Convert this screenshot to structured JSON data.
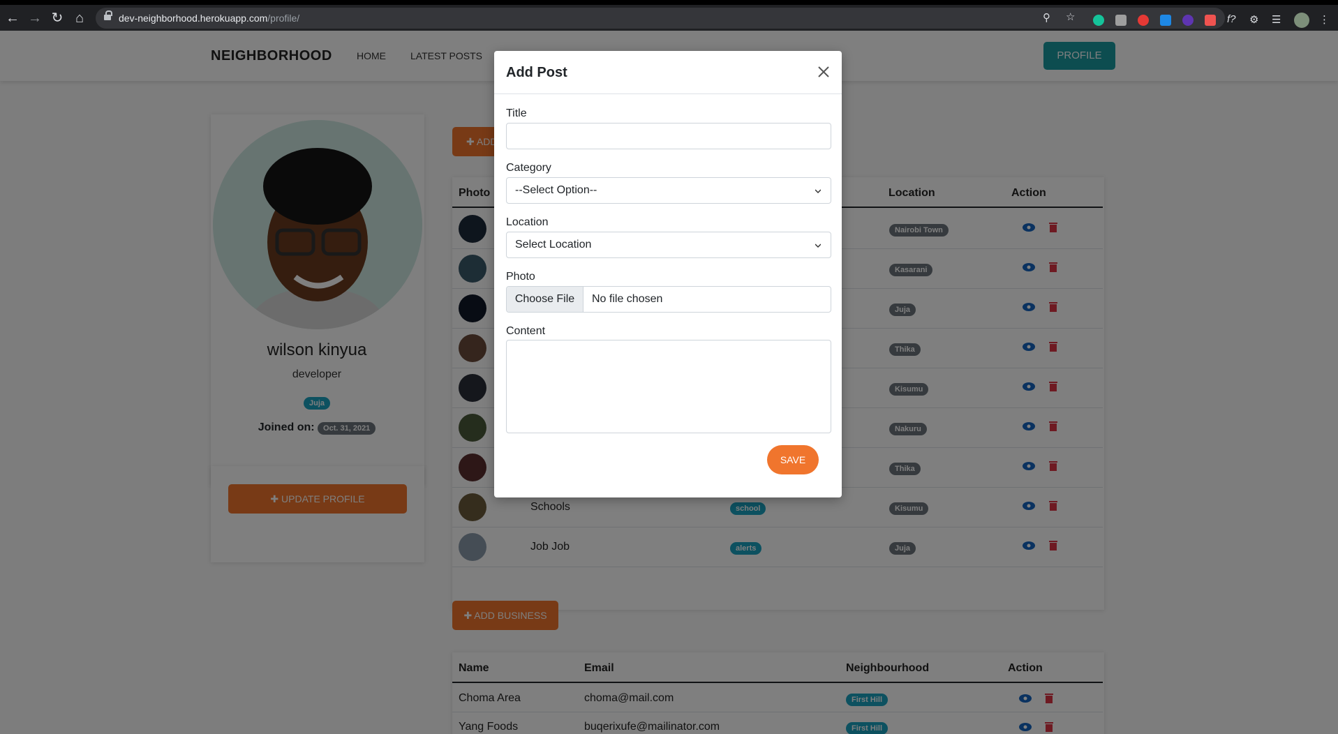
{
  "browser": {
    "url_host": "dev-neighborhood.herokuapp.com",
    "url_path": "/profile/"
  },
  "nav": {
    "brand": "NEIGHBORHOOD",
    "links": [
      "HOME",
      "LATEST POSTS"
    ],
    "profile_button": "PROFILE"
  },
  "profile": {
    "name": "wilson kinyua",
    "role": "developer",
    "location": "Juja",
    "joined_label": "Joined on:",
    "joined_date": "Oct. 31, 2021",
    "update_button": "UPDATE PROFILE"
  },
  "posts": {
    "add_button_partial": "ADD",
    "headers": {
      "photo": "Photo",
      "location": "Location",
      "action": "Action"
    },
    "rows": [
      {
        "title": "",
        "category": "",
        "location": "Nairobi Town"
      },
      {
        "title": "",
        "category": "",
        "location": "Kasarani"
      },
      {
        "title": "",
        "category": "",
        "location": "Juja"
      },
      {
        "title": "",
        "category": "",
        "location": "Thika"
      },
      {
        "title": "",
        "category": "",
        "location": "Kisumu"
      },
      {
        "title": "",
        "category": "",
        "location": "Nakuru"
      },
      {
        "title": "",
        "category": "",
        "location": "Thika"
      },
      {
        "title": "Schools",
        "category": "school",
        "location": "Kisumu"
      },
      {
        "title": "Job Job",
        "category": "alerts",
        "location": "Juja"
      }
    ]
  },
  "business": {
    "add_button": "ADD BUSINESS",
    "headers": {
      "name": "Name",
      "email": "Email",
      "neighbourhood": "Neighbourhood",
      "action": "Action"
    },
    "rows": [
      {
        "name": "Choma Area",
        "email": "choma@mail.com",
        "neighbourhood": "First Hill"
      },
      {
        "name": "Yang Foods",
        "email": "buqerixufe@mailinator.com",
        "neighbourhood": "First Hill"
      }
    ]
  },
  "modal": {
    "title": "Add Post",
    "fields": {
      "title_label": "Title",
      "title_value": "",
      "category_label": "Category",
      "category_value": "--Select Option--",
      "location_label": "Location",
      "location_value": "Select Location",
      "photo_label": "Photo",
      "photo_button": "Choose File",
      "photo_status": "No file chosen",
      "content_label": "Content",
      "content_value": ""
    },
    "save_button": "SAVE"
  },
  "colors": {
    "accent_orange": "#f0752d",
    "teal": "#1b9aa0",
    "badge_teal": "#1aa2c1",
    "badge_gray": "#6c757d",
    "eye_blue": "#1565c0",
    "trash_red": "#dc3545"
  },
  "icons": [
    "back-arrow-icon",
    "forward-arrow-icon",
    "reload-icon",
    "home-icon",
    "lock-icon",
    "zoom-icon",
    "star-icon",
    "extensions-icon",
    "menu-dots-icon",
    "plus-icon",
    "eye-icon",
    "trash-icon",
    "close-icon"
  ]
}
